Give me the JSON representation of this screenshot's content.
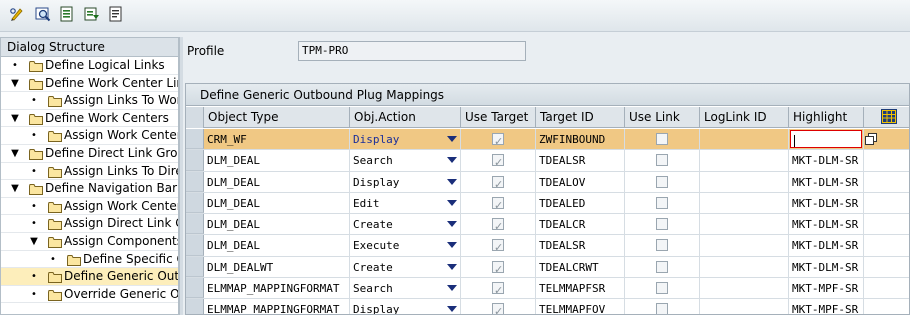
{
  "toolbar": {
    "buttons": [
      {
        "icon": "pencil-glasses-icon"
      },
      {
        "icon": "find-icon"
      },
      {
        "icon": "list-icon"
      },
      {
        "icon": "export-icon"
      },
      {
        "icon": "document-icon"
      }
    ]
  },
  "tree": {
    "header": "Dialog Structure",
    "items": [
      {
        "label": "Define Logical Links",
        "marker": "•"
      },
      {
        "label": "Define Work Center Links",
        "marker": "▼"
      },
      {
        "label": "Assign Links To Work Centers",
        "marker": "•"
      },
      {
        "label": "Define Work Centers",
        "marker": "▼"
      },
      {
        "label": "Assign Work Center Links",
        "marker": "•"
      },
      {
        "label": "Define Direct Link Groups",
        "marker": "▼"
      },
      {
        "label": "Assign Links To Direct Link Groups",
        "marker": "•"
      },
      {
        "label": "Define Navigation Bar Profile",
        "marker": "▼"
      },
      {
        "label": "Assign Work Centers",
        "marker": "•"
      },
      {
        "label": "Assign Direct Link Groups",
        "marker": "•"
      },
      {
        "label": "Assign Components To Profile",
        "marker": "▼"
      },
      {
        "label": "Define Specific Outbound",
        "marker": "•"
      },
      {
        "label": "Define Generic Outbound Plug Mappings",
        "marker": "•",
        "selected": true
      },
      {
        "label": "Override Generic OP Mappings",
        "marker": "•"
      }
    ]
  },
  "profile": {
    "label": "Profile",
    "value": "TPM-PRO"
  },
  "table": {
    "title": "Define Generic Outbound Plug Mappings",
    "columns": [
      "Object Type",
      "Obj.Action",
      "Use Target",
      "Target ID",
      "Use Link",
      "LogLink ID",
      "Highlight"
    ],
    "rows": [
      {
        "object_type": "CRM_WF",
        "action": "Display",
        "use_target": true,
        "target_id": "ZWFINBOUND",
        "use_link": false,
        "loglink_id": "",
        "highlight": "",
        "active": true
      },
      {
        "object_type": "DLM_DEAL",
        "action": "Search",
        "use_target": true,
        "target_id": "TDEALSR",
        "use_link": false,
        "loglink_id": "",
        "highlight": "MKT-DLM-SR"
      },
      {
        "object_type": "DLM_DEAL",
        "action": "Display",
        "use_target": true,
        "target_id": "TDEALOV",
        "use_link": false,
        "loglink_id": "",
        "highlight": "MKT-DLM-SR"
      },
      {
        "object_type": "DLM_DEAL",
        "action": "Edit",
        "use_target": true,
        "target_id": "TDEALED",
        "use_link": false,
        "loglink_id": "",
        "highlight": "MKT-DLM-SR"
      },
      {
        "object_type": "DLM_DEAL",
        "action": "Create",
        "use_target": true,
        "target_id": "TDEALCR",
        "use_link": false,
        "loglink_id": "",
        "highlight": "MKT-DLM-SR"
      },
      {
        "object_type": "DLM_DEAL",
        "action": "Execute",
        "use_target": true,
        "target_id": "TDEALSR",
        "use_link": false,
        "loglink_id": "",
        "highlight": "MKT-DLM-SR"
      },
      {
        "object_type": "DLM_DEALWT",
        "action": "Create",
        "use_target": true,
        "target_id": "TDEALCRWT",
        "use_link": false,
        "loglink_id": "",
        "highlight": "MKT-DLM-SR"
      },
      {
        "object_type": "ELMMAP_MAPPINGFORMAT",
        "action": "Search",
        "use_target": true,
        "target_id": "TELMMAPFSR",
        "use_link": false,
        "loglink_id": "",
        "highlight": "MKT-MPF-SR"
      },
      {
        "object_type": "ELMMAP_MAPPINGFORMAT",
        "action": "Display",
        "use_target": true,
        "target_id": "TELMMAPFOV",
        "use_link": false,
        "loglink_id": "",
        "highlight": "MKT-MPF-SR"
      }
    ]
  },
  "colors": {
    "active_row": "#f0c884",
    "selected_tree": "#fdeebb",
    "action_text": "#1a2e9a"
  }
}
